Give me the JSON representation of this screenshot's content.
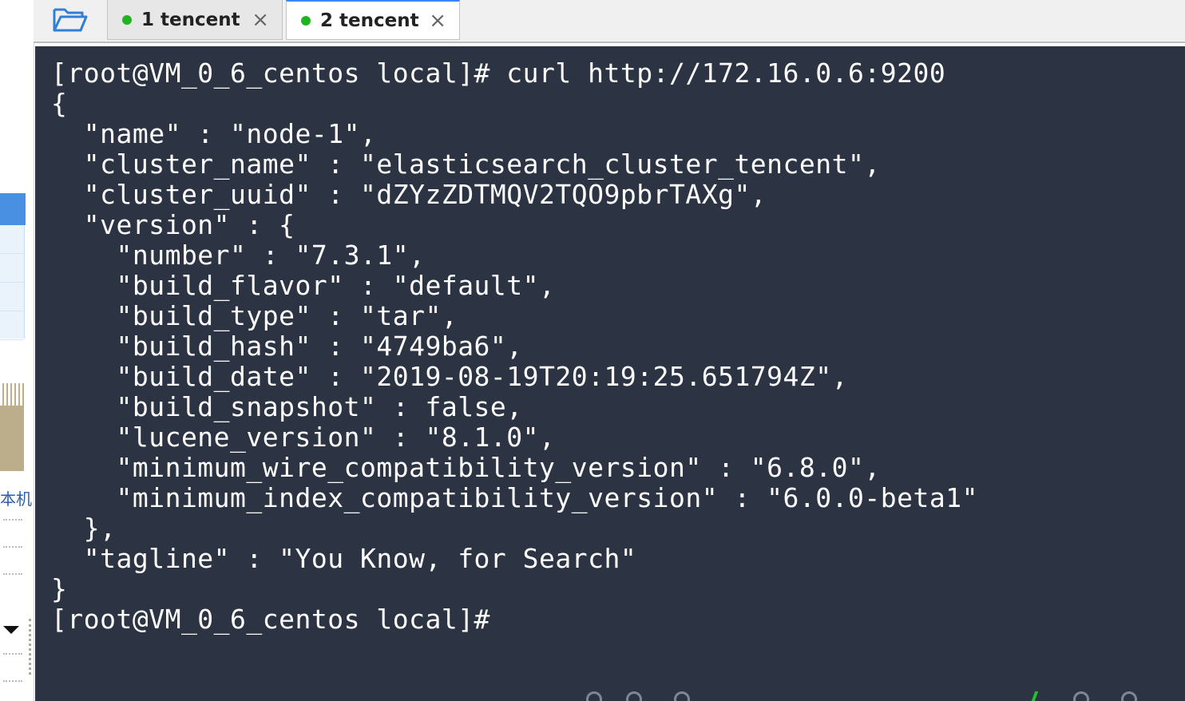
{
  "sidebar": {
    "partial_label": "本机"
  },
  "tabs": [
    {
      "label": "1 tencent",
      "close": "×",
      "status_color": "#22b322"
    },
    {
      "label": "2 tencent",
      "close": "×",
      "status_color": "#22b322",
      "active": true
    }
  ],
  "toolbar": {
    "open_folder_icon": "folder-open-icon"
  },
  "terminal": {
    "lines": [
      "[root@VM_0_6_centos local]# curl http://172.16.0.6:9200",
      "{",
      "  \"name\" : \"node-1\",",
      "  \"cluster_name\" : \"elasticsearch_cluster_tencent\",",
      "  \"cluster_uuid\" : \"dZYzZDTMQV2TQO9pbrTAXg\",",
      "  \"version\" : {",
      "    \"number\" : \"7.3.1\",",
      "    \"build_flavor\" : \"default\",",
      "    \"build_type\" : \"tar\",",
      "    \"build_hash\" : \"4749ba6\",",
      "    \"build_date\" : \"2019-08-19T20:19:25.651794Z\",",
      "    \"build_snapshot\" : false,",
      "    \"lucene_version\" : \"8.1.0\",",
      "    \"minimum_wire_compatibility_version\" : \"6.8.0\",",
      "    \"minimum_index_compatibility_version\" : \"6.0.0-beta1\"",
      "  },",
      "  \"tagline\" : \"You Know, for Search\"",
      "}",
      "[root@VM_0_6_centos local]#"
    ],
    "background": "#2c3443",
    "foreground": "#ffffff"
  }
}
